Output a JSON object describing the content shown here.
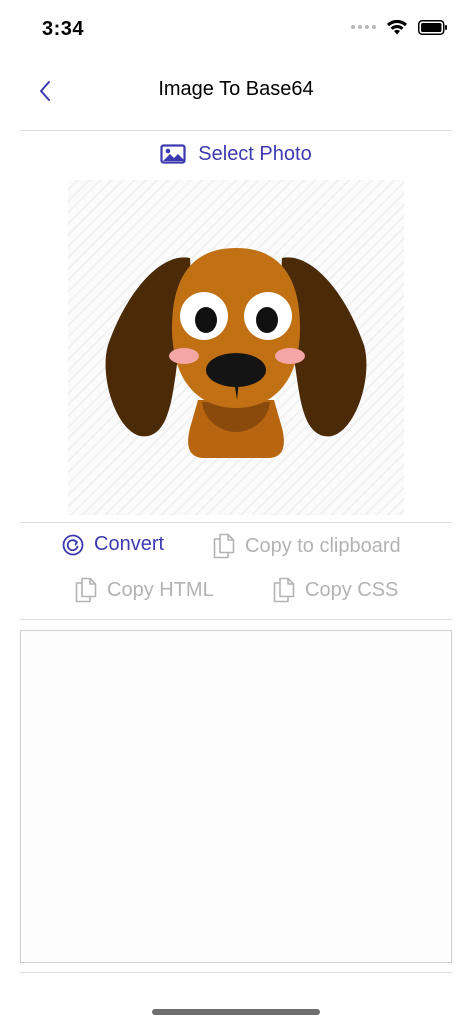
{
  "status": {
    "time": "3:34"
  },
  "nav": {
    "title": "Image To Base64",
    "back_icon": "chevron-left-icon"
  },
  "select_photo": {
    "label": "Select Photo",
    "icon": "photo-icon"
  },
  "preview": {
    "subject": "cartoon-dog-illustration"
  },
  "actions": {
    "convert_label": "Convert",
    "copy_clipboard_label": "Copy to clipboard",
    "copy_html_label": "Copy HTML",
    "copy_css_label": "Copy CSS"
  },
  "output": {
    "value": ""
  },
  "colors": {
    "accent": "#3d3ab0",
    "disabled": "#b3b3b3",
    "divider": "#dcdcdc"
  }
}
